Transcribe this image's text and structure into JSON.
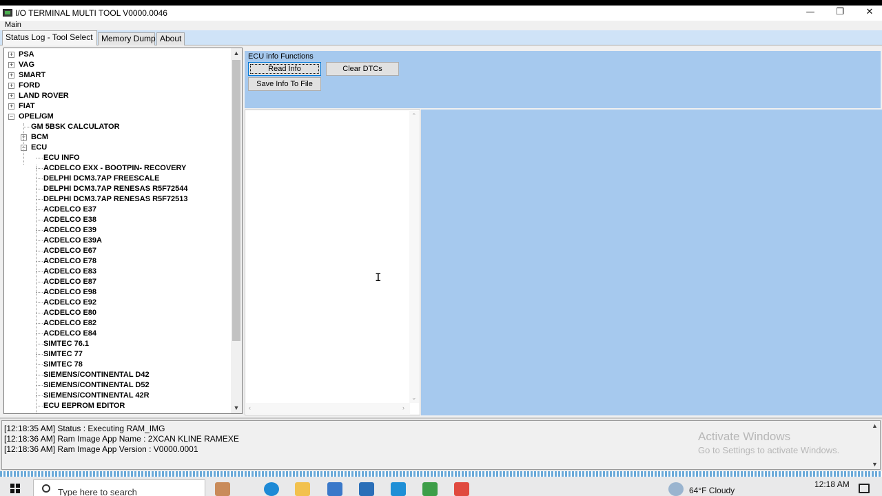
{
  "window": {
    "title": "I/O TERMINAL MULTI TOOL V0000.0046",
    "minimize": "—",
    "restore": "❐",
    "close": "✕"
  },
  "menu": {
    "main": "Main"
  },
  "tabs": [
    {
      "label": "Status Log - Tool Select",
      "active": true
    },
    {
      "label": "Memory Dump",
      "active": false
    },
    {
      "label": "About",
      "active": false
    }
  ],
  "tree": {
    "expand_glyph": "+",
    "collapse_glyph": "−",
    "top_level": [
      "PSA",
      "VAG",
      "SMART",
      "FORD",
      "LAND ROVER",
      "FIAT"
    ],
    "opel": "OPEL/GM",
    "opel_children": [
      "GM 5BSK CALCULATOR",
      "BCM"
    ],
    "ecu": "ECU",
    "ecu_children": [
      "ECU INFO",
      "ACDELCO EXX - BOOTPIN- RECOVERY",
      "DELPHI DCM3.7AP FREESCALE",
      "DELPHI DCM3.7AP RENESAS R5F72544",
      "DELPHI DCM3.7AP RENESAS R5F72513",
      "ACDELCO E37",
      "ACDELCO E38",
      "ACDELCO E39",
      "ACDELCO E39A",
      "ACDELCO E67",
      "ACDELCO E78",
      "ACDELCO E83",
      "ACDELCO E87",
      "ACDELCO E98",
      "ACDELCO E92",
      "ACDELCO E80",
      "ACDELCO E82",
      "ACDELCO E84",
      "SIMTEC 76.1",
      "SIMTEC 77",
      "SIMTEC 78",
      "SIEMENS/CONTINENTAL D42",
      "SIEMENS/CONTINENTAL D52",
      "SIEMENS/CONTINENTAL 42R",
      "ECU EEPROM EDITOR"
    ]
  },
  "ecu_functions": {
    "group_label": "ECU info Functions",
    "read_info": "Read Info",
    "clear_dtcs": "Clear DTCs",
    "save_info": "Save Info To File"
  },
  "log": {
    "lines": [
      "[12:18:35 AM] Status : Executing RAM_IMG",
      "[12:18:36 AM] Ram Image App Name : 2XCAN KLINE RAMEXE",
      "[12:18:36 AM] Ram Image App Version : V0000.0001"
    ],
    "watermark_title": "Activate Windows",
    "watermark_sub": "Go to Settings to activate Windows."
  },
  "taskbar": {
    "search_placeholder": "Type here to search",
    "weather": "64°F  Cloudy",
    "clock": "12:18 AM"
  },
  "colors": {
    "panel_blue": "#a6c9ee",
    "tab_strip": "#cfe3f7",
    "focus_border": "#0078d7"
  }
}
